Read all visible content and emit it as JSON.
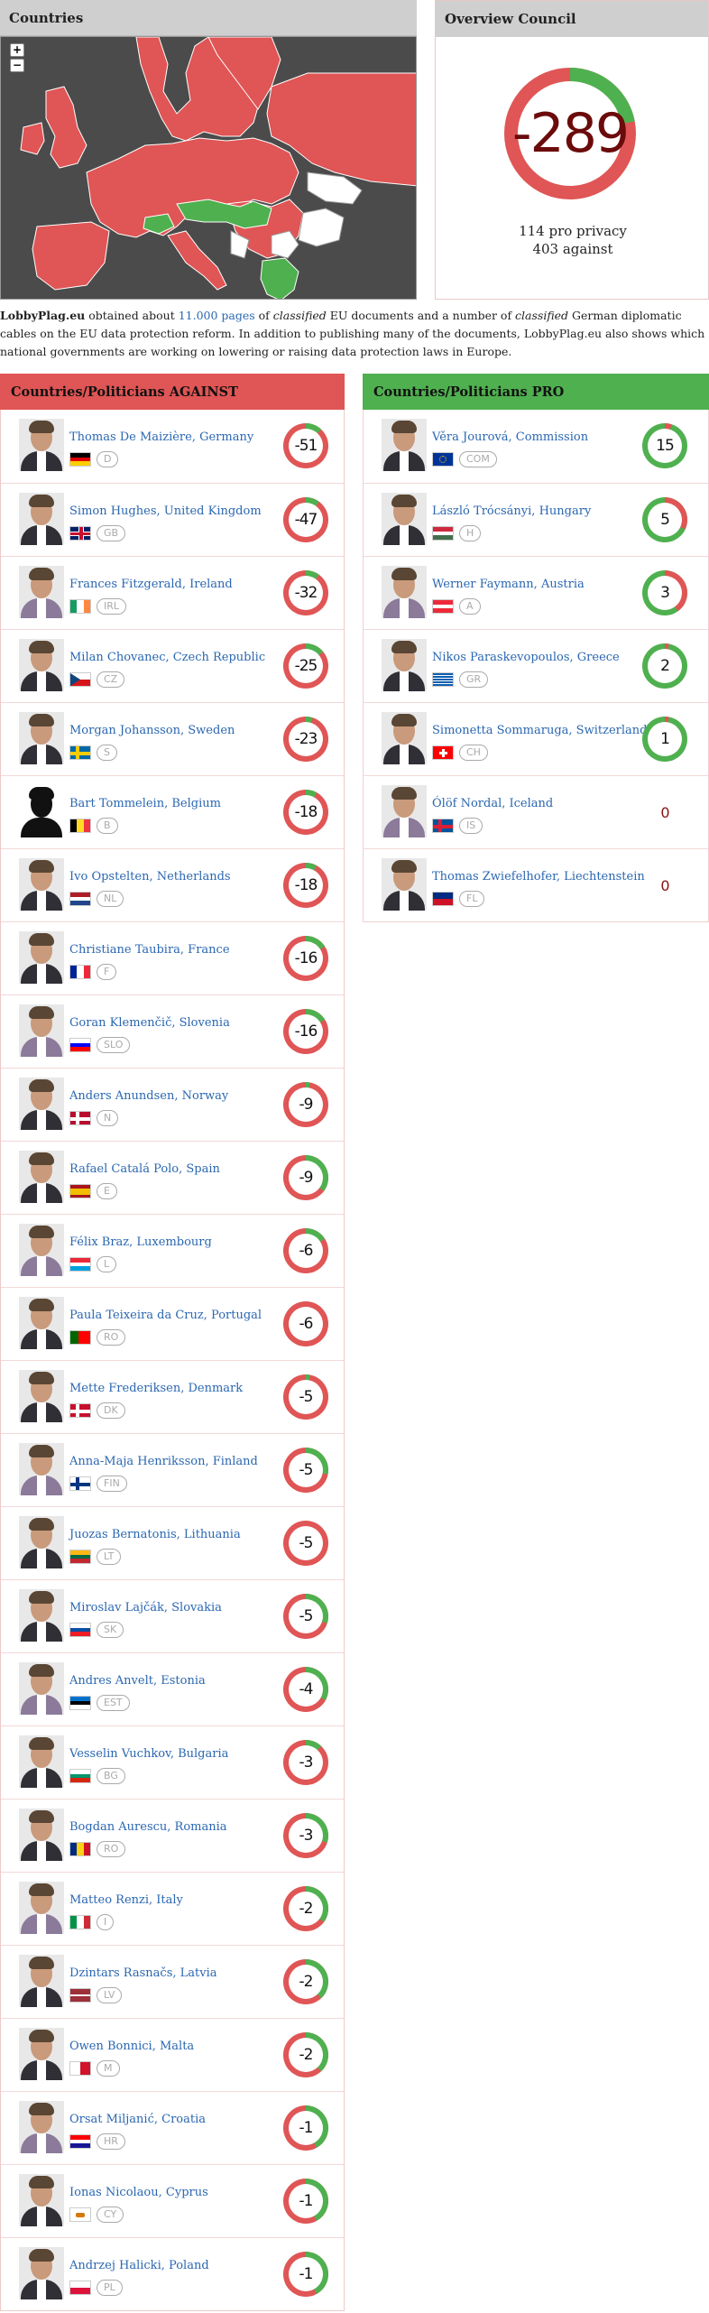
{
  "countries_panel": {
    "title": "Countries"
  },
  "map": {
    "zoom_in": "+",
    "zoom_out": "−"
  },
  "overview": {
    "title": "Overview Council",
    "value": "-289",
    "pro_line": "114 pro privacy",
    "against_line": "403 against",
    "pro": 114,
    "against": 403
  },
  "intro": {
    "site": "LobbyPlag.eu",
    "t1": " obtained about ",
    "link": "11.000 pages",
    "t2": " of ",
    "em1": "classified",
    "t3": " EU documents and a number of ",
    "em2": "classified",
    "t4": " German diplomatic cables on the EU data protection reform. In addition to publishing many of the documents, LobbyPlag.eu also shows which national governments are working on lowering or raising data protection laws in Europe."
  },
  "against": {
    "title": "Countries/Politicians AGAINST",
    "items": [
      {
        "name": "Thomas De Maizière, Germany",
        "code": "D",
        "score": "-51",
        "pro_frac": 0.12,
        "flag": [
          "#000000",
          "#dd0000",
          "#ffce00"
        ],
        "flag_dir": "h"
      },
      {
        "name": "Simon Hughes, United Kingdom",
        "code": "GB",
        "score": "-47",
        "pro_frac": 0.1,
        "flag": [
          "#012169",
          "#ffffff",
          "#c8102e"
        ],
        "flag_dir": "uk"
      },
      {
        "name": "Frances Fitzgerald, Ireland",
        "code": "IRL",
        "score": "-32",
        "pro_frac": 0.1,
        "flag": [
          "#169b62",
          "#ffffff",
          "#ff883e"
        ],
        "flag_dir": "v"
      },
      {
        "name": "Milan Chovanec, Czech Republic",
        "code": "CZ",
        "score": "-25",
        "pro_frac": 0.14,
        "flag": [
          "#ffffff",
          "#d7141a",
          "#11457e"
        ],
        "flag_dir": "cz"
      },
      {
        "name": "Morgan Johansson, Sweden",
        "code": "S",
        "score": "-23",
        "pro_frac": 0.05,
        "flag": [
          "#006aa7",
          "#fecc00"
        ],
        "flag_dir": "nordic"
      },
      {
        "name": "Bart Tommelein, Belgium",
        "code": "B",
        "score": "-18",
        "pro_frac": 0.08,
        "flag": [
          "#000000",
          "#fdda24",
          "#ef3340"
        ],
        "flag_dir": "v"
      },
      {
        "name": "Ivo Opstelten, Netherlands",
        "code": "NL",
        "score": "-18",
        "pro_frac": 0.08,
        "flag": [
          "#ae1c28",
          "#ffffff",
          "#21468b"
        ],
        "flag_dir": "h"
      },
      {
        "name": "Christiane Taubira, France",
        "code": "F",
        "score": "-16",
        "pro_frac": 0.16,
        "flag": [
          "#002395",
          "#ffffff",
          "#ed2939"
        ],
        "flag_dir": "v"
      },
      {
        "name": "Goran Klemenčič, Slovenia",
        "code": "SLO",
        "score": "-16",
        "pro_frac": 0.16,
        "flag": [
          "#ffffff",
          "#0000ff",
          "#ff0000"
        ],
        "flag_dir": "h"
      },
      {
        "name": "Anders Anundsen, Norway",
        "code": "N",
        "score": "-9",
        "pro_frac": 0.03,
        "flag": [
          "#ba0c2f",
          "#ffffff"
        ],
        "flag_dir": "nordic"
      },
      {
        "name": "Rafael Catalá Polo, Spain",
        "code": "E",
        "score": "-9",
        "pro_frac": 0.35,
        "flag": [
          "#aa151b",
          "#f1bf00",
          "#aa151b"
        ],
        "flag_dir": "es"
      },
      {
        "name": "Félix Braz, Luxembourg",
        "code": "L",
        "score": "-6",
        "pro_frac": 0.16,
        "flag": [
          "#ed2939",
          "#ffffff",
          "#00a1de"
        ],
        "flag_dir": "h"
      },
      {
        "name": "Paula Teixeira da Cruz, Portugal",
        "code": "RO",
        "score": "-6",
        "pro_frac": 0.0,
        "flag": [
          "#006600",
          "#ff0000"
        ],
        "flag_dir": "pt"
      },
      {
        "name": "Mette Frederiksen, Denmark",
        "code": "DK",
        "score": "-5",
        "pro_frac": 0.03,
        "flag": [
          "#c8102e",
          "#ffffff"
        ],
        "flag_dir": "nordic"
      },
      {
        "name": "Anna-Maja Henriksson, Finland",
        "code": "FIN",
        "score": "-5",
        "pro_frac": 0.28,
        "flag": [
          "#ffffff",
          "#003580"
        ],
        "flag_dir": "nordic"
      },
      {
        "name": "Juozas Bernatonis, Lithuania",
        "code": "LT",
        "score": "-5",
        "pro_frac": 0.0,
        "flag": [
          "#fdb913",
          "#006a44",
          "#c1272d"
        ],
        "flag_dir": "h"
      },
      {
        "name": "Miroslav Lajčák, Slovakia",
        "code": "SK",
        "score": "-5",
        "pro_frac": 0.3,
        "flag": [
          "#ffffff",
          "#0b4ea2",
          "#ee1c25"
        ],
        "flag_dir": "h"
      },
      {
        "name": "Andres Anvelt, Estonia",
        "code": "EST",
        "score": "-4",
        "pro_frac": 0.33,
        "flag": [
          "#0072ce",
          "#000000",
          "#ffffff"
        ],
        "flag_dir": "h"
      },
      {
        "name": "Vesselin Vuchkov, Bulgaria",
        "code": "BG",
        "score": "-3",
        "pro_frac": 0.12,
        "flag": [
          "#ffffff",
          "#00966e",
          "#d62612"
        ],
        "flag_dir": "h"
      },
      {
        "name": "Bogdan Aurescu, Romania",
        "code": "RO",
        "score": "-3",
        "pro_frac": 0.3,
        "flag": [
          "#002b7f",
          "#fcd116",
          "#ce1126"
        ],
        "flag_dir": "v"
      },
      {
        "name": "Matteo Renzi, Italy",
        "code": "I",
        "score": "-2",
        "pro_frac": 0.35,
        "flag": [
          "#009246",
          "#ffffff",
          "#ce2b37"
        ],
        "flag_dir": "v"
      },
      {
        "name": "Dzintars Rasnačs, Latvia",
        "code": "LV",
        "score": "-2",
        "pro_frac": 0.38,
        "flag": [
          "#9e3039",
          "#ffffff",
          "#9e3039"
        ],
        "flag_dir": "lv"
      },
      {
        "name": "Owen Bonnici, Malta",
        "code": "M",
        "score": "-2",
        "pro_frac": 0.38,
        "flag": [
          "#ffffff",
          "#cf142b"
        ],
        "flag_dir": "v2"
      },
      {
        "name": "Orsat Miljanić, Croatia",
        "code": "HR",
        "score": "-1",
        "pro_frac": 0.42,
        "flag": [
          "#ff0000",
          "#ffffff",
          "#171796"
        ],
        "flag_dir": "h"
      },
      {
        "name": "Ionas Nicolaou, Cyprus",
        "code": "CY",
        "score": "-1",
        "pro_frac": 0.42,
        "flag": [
          "#ffffff",
          "#d57800"
        ],
        "flag_dir": "cy"
      },
      {
        "name": "Andrzej Halicki, Poland",
        "code": "PL",
        "score": "-1",
        "pro_frac": 0.42,
        "flag": [
          "#ffffff",
          "#dc143c"
        ],
        "flag_dir": "h"
      }
    ]
  },
  "pro": {
    "title": "Countries/Politicians PRO",
    "items": [
      {
        "name": "Věra Jourová, Commission",
        "code": "COM",
        "score": "15",
        "pro_frac": 0.95,
        "flag": [
          "#003399",
          "#ffcc00"
        ],
        "flag_dir": "eu"
      },
      {
        "name": "László Trócsányi, Hungary",
        "code": "H",
        "score": "5",
        "pro_frac": 0.68,
        "flag": [
          "#cd2a3e",
          "#ffffff",
          "#436f4d"
        ],
        "flag_dir": "h"
      },
      {
        "name": "Werner Faymann, Austria",
        "code": "A",
        "score": "3",
        "pro_frac": 0.6,
        "flag": [
          "#ed2939",
          "#ffffff",
          "#ed2939"
        ],
        "flag_dir": "h"
      },
      {
        "name": "Nikos Paraskevopoulos, Greece",
        "code": "GR",
        "score": "2",
        "pro_frac": 0.97,
        "flag": [
          "#0d5eaf",
          "#ffffff"
        ],
        "flag_dir": "gr"
      },
      {
        "name": "Simonetta Sommaruga, Switzerland",
        "code": "CH",
        "score": "1",
        "pro_frac": 0.97,
        "flag": [
          "#ff0000",
          "#ffffff"
        ],
        "flag_dir": "ch"
      },
      {
        "name": "Ólöf Nordal, Iceland",
        "code": "IS",
        "score": "0",
        "pro_frac": null,
        "flag": [
          "#02529c",
          "#dc1e35"
        ],
        "flag_dir": "nordic"
      },
      {
        "name": "Thomas Zwiefelhofer, Liechtenstein",
        "code": "FL",
        "score": "0",
        "pro_frac": null,
        "flag": [
          "#002b7f",
          "#ce1126"
        ],
        "flag_dir": "h"
      }
    ]
  },
  "colors": {
    "against": "#e05555",
    "pro": "#4fb04f",
    "link": "#2a67b1"
  }
}
